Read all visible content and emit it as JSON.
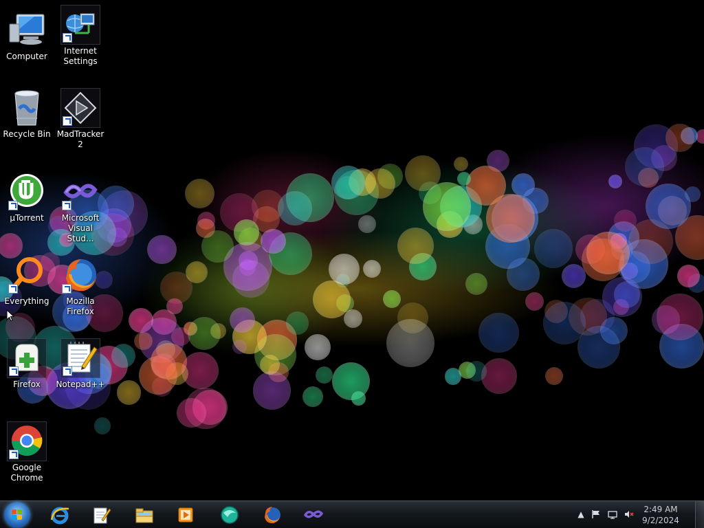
{
  "desktop": {
    "icons": [
      {
        "id": "computer",
        "label": "Computer",
        "icon": "computer-icon"
      },
      {
        "id": "internet-settings",
        "label": "Internet Settings",
        "icon": "network-settings-icon"
      },
      {
        "id": "recycle-bin",
        "label": "Recycle Bin",
        "icon": "recycle-bin-icon"
      },
      {
        "id": "madtracker",
        "label": "MadTracker 2",
        "icon": "madtracker-icon"
      },
      {
        "id": "utorrent",
        "label": "µTorrent",
        "icon": "utorrent-icon"
      },
      {
        "id": "visual-studio",
        "label": "Microsoft Visual Stud...",
        "icon": "visual-studio-icon"
      },
      {
        "id": "everything",
        "label": "Everything",
        "icon": "everything-search-icon"
      },
      {
        "id": "mozilla-firefox",
        "label": "Mozilla Firefox",
        "icon": "firefox-icon"
      },
      {
        "id": "firefox-installer",
        "label": "Firefox",
        "icon": "firefox-installer-icon"
      },
      {
        "id": "notepadpp",
        "label": "Notepad++",
        "icon": "notepad-plus-plus-icon"
      },
      {
        "id": "google-chrome",
        "label": "Google Chrome",
        "icon": "chrome-icon"
      }
    ]
  },
  "taskbar": {
    "start": {
      "icon": "windows-start-icon"
    },
    "pinned": [
      {
        "id": "ie",
        "icon": "internet-explorer-icon"
      },
      {
        "id": "notepad",
        "icon": "notepad-icon"
      },
      {
        "id": "explorer",
        "icon": "file-explorer-icon"
      },
      {
        "id": "media-player",
        "icon": "media-player-icon"
      },
      {
        "id": "app-teal",
        "icon": "teal-app-icon"
      },
      {
        "id": "firefox",
        "icon": "firefox-icon"
      },
      {
        "id": "visual-studio",
        "icon": "visual-studio-icon"
      }
    ],
    "tray": {
      "icons": [
        "show-hidden-icons-icon",
        "action-center-flag-icon",
        "network-icon",
        "volume-muted-icon"
      ],
      "time": "2:49 AM",
      "date": "9/2/2024"
    }
  },
  "colors": {
    "background": "#000000",
    "taskbar": "#14181d",
    "text": "#ffffff",
    "clock_text": "#c9cfd6"
  }
}
